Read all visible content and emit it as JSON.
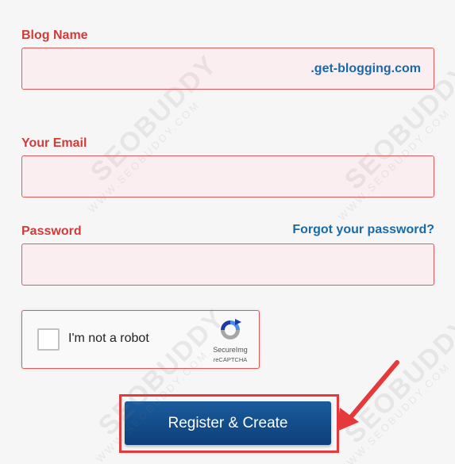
{
  "form": {
    "blog_name": {
      "label": "Blog Name",
      "value": "",
      "suffix": ".get-blogging.com"
    },
    "email": {
      "label": "Your Email",
      "value": ""
    },
    "password": {
      "label": "Password",
      "value": "",
      "forgot_link": "Forgot your password?"
    }
  },
  "captcha": {
    "label": "I'm not a robot",
    "brand": "SecureImg",
    "subtext": "reCAPTCHA",
    "icon": "recaptcha-icon"
  },
  "submit": {
    "label": "Register & Create"
  },
  "watermark": {
    "brand": "SEOBUDDY",
    "url": "WWW.SEOBUDDY.COM"
  },
  "colors": {
    "label_red": "#d33a3a",
    "field_border": "#e3585a",
    "field_bg": "#fbeef0",
    "link_blue": "#1a6aa8",
    "button_blue": "#0d3f7a",
    "highlight_red": "#e5393b"
  }
}
